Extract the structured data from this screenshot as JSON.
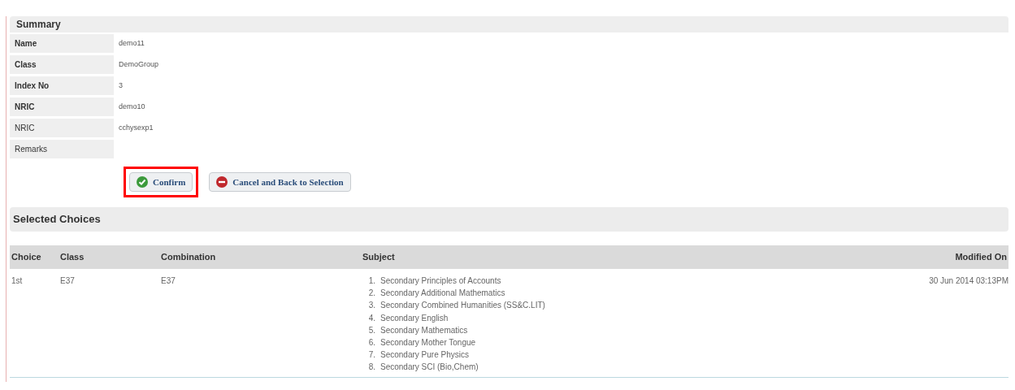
{
  "summary": {
    "title": "Summary",
    "fields": [
      {
        "label": "Name",
        "value": "demo11",
        "bold": true
      },
      {
        "label": "Class",
        "value": "DemoGroup",
        "bold": true
      },
      {
        "label": "Index No",
        "value": "3",
        "bold": true
      },
      {
        "label": "NRIC",
        "value": "demo10",
        "bold": true
      },
      {
        "label": "NRIC",
        "value": "cchysexp1",
        "bold": false
      },
      {
        "label": "Remarks",
        "bold": false
      }
    ],
    "buttons": [
      {
        "label": "Confirm",
        "kind": "confirm",
        "highlighted": true
      },
      {
        "label": "Cancel and Back to Selection",
        "kind": "cancel",
        "highlighted": false
      }
    ]
  },
  "choices": {
    "title": "Selected Choices",
    "columns": [
      "Choice",
      "Class",
      "Combination",
      "Subject",
      "Modified On"
    ],
    "rows": [
      {
        "choice": "1st",
        "class": "E37",
        "combination": "E37",
        "modified_on": "30 Jun 2014 03:13PM",
        "subjects": [
          {
            "number": "1.",
            "name": "Secondary Principles of Accounts"
          },
          {
            "number": "2.",
            "name": "Secondary Additional Mathematics"
          },
          {
            "number": "3.",
            "name": "Secondary Combined Humanities (SS&C.LIT)"
          },
          {
            "number": "4.",
            "name": "Secondary English"
          },
          {
            "number": "5.",
            "name": "Secondary Mathematics"
          },
          {
            "number": "6.",
            "name": "Secondary Mother Tongue"
          },
          {
            "number": "7.",
            "name": "Secondary Pure Physics"
          },
          {
            "number": "8.",
            "name": "Secondary SCI (Bio,Chem)"
          }
        ]
      }
    ]
  }
}
